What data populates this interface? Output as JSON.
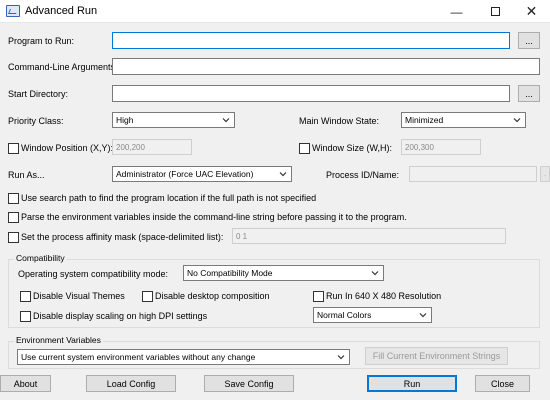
{
  "window": {
    "title": "Advanced Run"
  },
  "form": {
    "program_label": "Program to Run:",
    "program_value": "",
    "browse_label": "...",
    "args_label": "Command-Line Arguments:",
    "args_value": "",
    "startdir_label": "Start Directory:",
    "startdir_value": "",
    "priority_label": "Priority Class:",
    "priority_value": "High",
    "mainwin_label": "Main Window State:",
    "mainwin_value": "Minimized",
    "winpos_label": "Window Position (X,Y):",
    "winpos_value": "200,200",
    "winsize_label": "Window Size (W,H):",
    "winsize_value": "200,300",
    "runas_label": "Run As...",
    "runas_value": "Administrator (Force UAC Elevation)",
    "processid_label": "Process ID/Name:",
    "processid_value": "",
    "search_path_label": "Use search path to find the program location if the full path is not specified",
    "parse_env_label": "Parse the environment variables inside the command-line string before passing it to the program.",
    "affinity_label": "Set the process affinity mask (space-delimited list):",
    "affinity_value": "0 1"
  },
  "compat": {
    "group_title": "Compatibility",
    "mode_label": "Operating system compatibility mode:",
    "mode_value": "No Compatibility Mode",
    "disable_themes": "Disable Visual Themes",
    "disable_composition": "Disable desktop composition",
    "run_640": "Run In 640 X 480 Resolution",
    "disable_dpi": "Disable display scaling on high DPI settings",
    "colors_value": "Normal Colors"
  },
  "env": {
    "group_title": "Environment Variables",
    "option_value": "Use current system environment variables without any change",
    "fill_button": "Fill Current Environment Strings"
  },
  "buttons": {
    "about": "About",
    "load": "Load Config",
    "save": "Save Config",
    "run": "Run",
    "close": "Close"
  }
}
